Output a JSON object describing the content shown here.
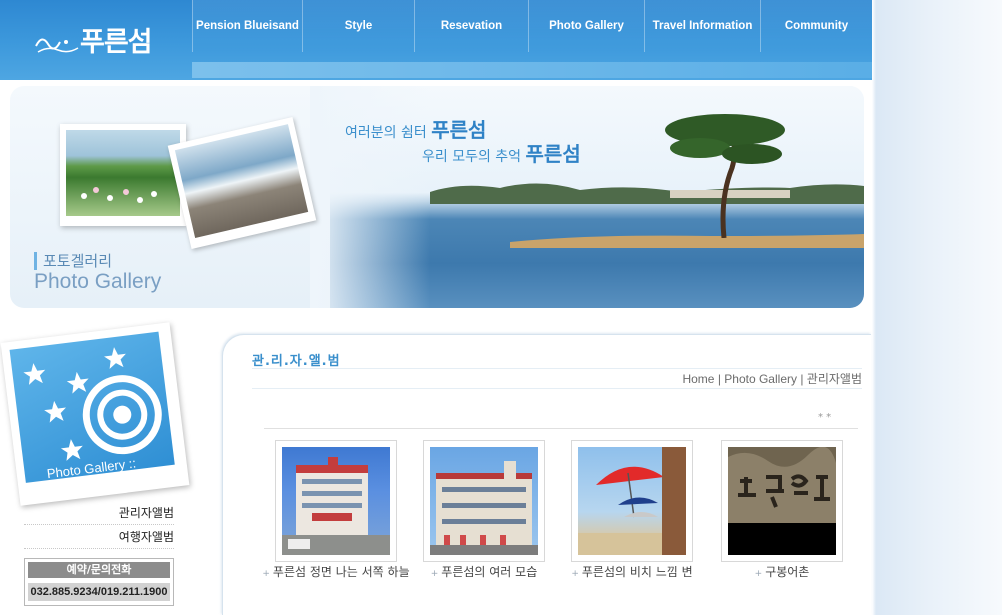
{
  "brand": {
    "logo_text": "푸른섬"
  },
  "nav": [
    {
      "label": "Pension Blueisand"
    },
    {
      "label": "Style"
    },
    {
      "label": "Resevation"
    },
    {
      "label": "Photo Gallery"
    },
    {
      "label": "Travel Information"
    },
    {
      "label": "Community"
    }
  ],
  "hero": {
    "slogan_line1_small": "여러분의 쉼터",
    "slogan_line1_big": "푸른섬",
    "slogan_line2_small": "우리 모두의 추억",
    "slogan_line2_big": "푸른섬",
    "section_ko": "포토겔러리",
    "section_en": "Photo Gallery"
  },
  "sidebar": {
    "badge_caption": "Photo Gallery ::",
    "links": [
      {
        "label": "관리자앨범"
      },
      {
        "label": "여행자앨범"
      }
    ],
    "contact": {
      "title": "예약/문의전화",
      "phone": "032.885.9234/019.211.1900"
    }
  },
  "content": {
    "page_title": "관.리.자.앨.범",
    "breadcrumb": [
      "Home",
      "Photo Gallery",
      "관리자앨범"
    ],
    "breadcrumb_sep": "|",
    "stars_note": "* *",
    "gallery": [
      {
        "caption": "푸른섬 정면 나는 서쪽 하늘"
      },
      {
        "caption": "푸른섬의 여러 모습"
      },
      {
        "caption": "푸른섬의 비치 느낌 변"
      },
      {
        "caption": "구봉어촌"
      }
    ]
  },
  "colors": {
    "header_blue": "#2e88d2",
    "accent_blue": "#3a8fcc",
    "logo_yellow": "#ffe23b"
  }
}
